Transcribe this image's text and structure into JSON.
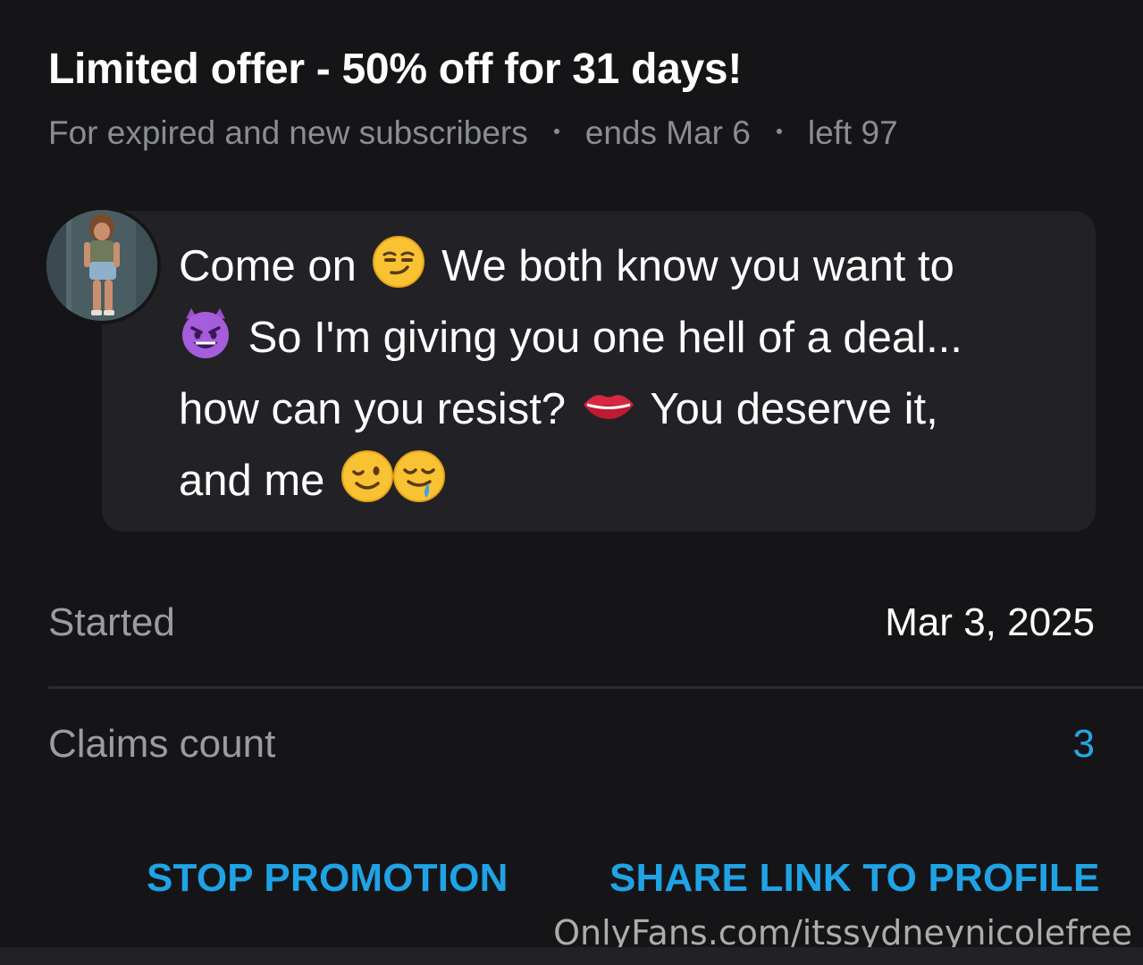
{
  "promo": {
    "title": "Limited offer - 50% off for 31 days!",
    "audience": "For expired and new subscribers",
    "ends": "ends Mar 6",
    "left": "left 97"
  },
  "message": {
    "line1_a": "Come on",
    "line1_b": "We both know you want to",
    "line2": "So I'm giving you one hell of a deal...",
    "line3_a": "how can you resist?",
    "line3_b": "You deserve it,",
    "line4": "and me"
  },
  "emoji": [
    "smirking-face",
    "smiling-devil",
    "lips",
    "winking-face",
    "drooling-face"
  ],
  "details": {
    "started_label": "Started",
    "started_value": "Mar 3, 2025",
    "claims_label": "Claims count",
    "claims_value": "3"
  },
  "actions": {
    "stop": "STOP PROMOTION",
    "share": "SHARE LINK TO PROFILE"
  },
  "watermark": "OnlyFans.com/itssydneynicolefree",
  "colors": {
    "background": "#151517",
    "bubble": "#222226",
    "accent": "#1fa3e6",
    "muted": "#8a8d93"
  }
}
